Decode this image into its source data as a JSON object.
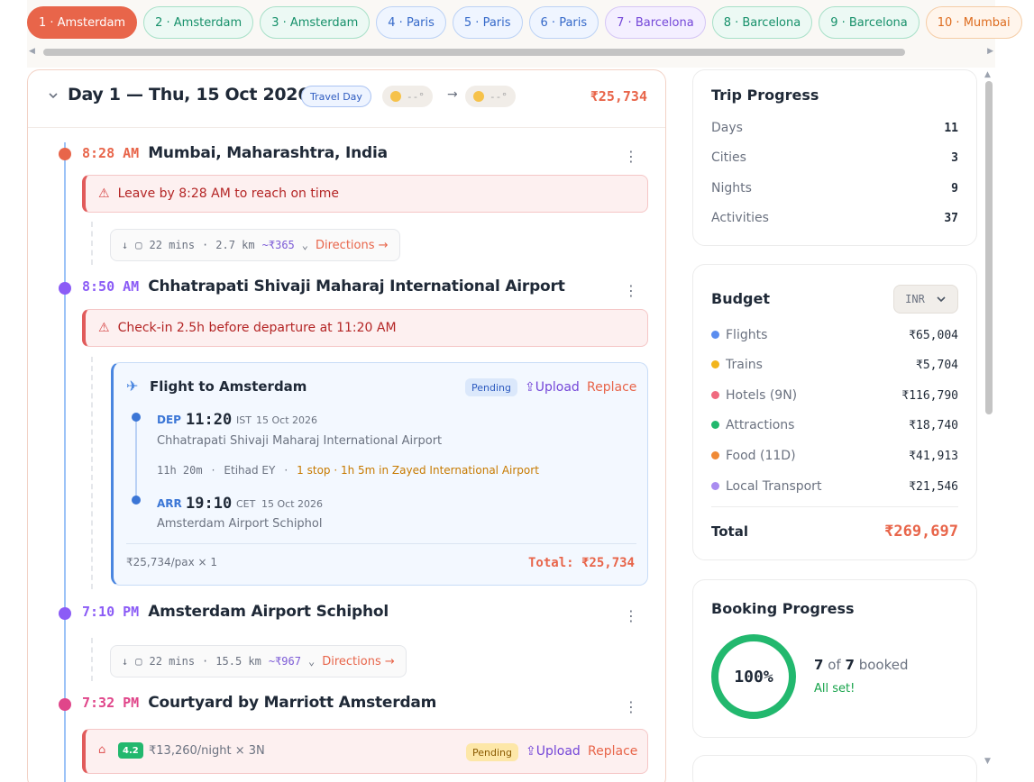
{
  "tabs": [
    {
      "label": "1 · Amsterdam",
      "kind": "active"
    },
    {
      "label": "2 · Amsterdam",
      "kind": "ams"
    },
    {
      "label": "3 · Amsterdam",
      "kind": "ams"
    },
    {
      "label": "4 · Paris",
      "kind": "par"
    },
    {
      "label": "5 · Paris",
      "kind": "par"
    },
    {
      "label": "6 · Paris",
      "kind": "par"
    },
    {
      "label": "7 · Barcelona",
      "kind": "bar"
    },
    {
      "label": "8 · Barcelona",
      "kind": "ams"
    },
    {
      "label": "9 · Barcelona",
      "kind": "ams"
    },
    {
      "label": "10 · Mumbai",
      "kind": "mum"
    }
  ],
  "day": {
    "title": "Day 1 — Thu, 15 Oct 2026",
    "tag": "Travel Day",
    "weather_from": "--°",
    "weather_to": "--°",
    "cost": "₹25,734"
  },
  "stops": [
    {
      "time": "8:28 AM",
      "name": "Mumbai, Maharashtra, India",
      "color": "#e8654a"
    },
    {
      "time": "8:50 AM",
      "name": "Chhatrapati Shivaji Maharaj International Airport",
      "color": "#8b5cf6"
    },
    {
      "time": "7:10 PM",
      "name": "Amsterdam Airport Schiphol",
      "color": "#8b5cf6"
    },
    {
      "time": "7:32 PM",
      "name": "Courtyard by Marriott Amsterdam",
      "color": "#e0468a"
    }
  ],
  "alerts": {
    "leave": "Leave by 8:28 AM to reach on time",
    "checkin": "Check-in 2.5h before departure at 11:20 AM"
  },
  "transits": [
    {
      "duration": "22 mins",
      "distance": "2.7 km",
      "price": "~₹365",
      "directions": "Directions →"
    },
    {
      "duration": "22 mins",
      "distance": "15.5 km",
      "price": "~₹967",
      "directions": "Directions →"
    }
  ],
  "flight": {
    "title": "Flight to Amsterdam",
    "status": "Pending",
    "upload": "Upload",
    "replace": "Replace",
    "dep_label": "DEP",
    "dep_time": "11:20",
    "dep_tz": "IST",
    "dep_date": "15 Oct 2026",
    "dep_airport": "Chhatrapati Shivaji Maharaj International Airport",
    "duration": "11h 20m",
    "airline": "Etihad EY",
    "stops": "1 stop · 1h 5m in Zayed International Airport",
    "arr_label": "ARR",
    "arr_time": "19:10",
    "arr_tz": "CET",
    "arr_date": "15 Oct 2026",
    "arr_airport": "Amsterdam Airport Schiphol",
    "pax": "₹25,734/pax × 1",
    "total": "Total: ₹25,734"
  },
  "hotel": {
    "rating": "4.2",
    "price": "₹13,260/night × 3N",
    "status": "Pending",
    "upload": "Upload",
    "replace": "Replace"
  },
  "trip_progress": {
    "title": "Trip Progress",
    "rows": [
      {
        "label": "Days",
        "value": "11"
      },
      {
        "label": "Cities",
        "value": "3"
      },
      {
        "label": "Nights",
        "value": "9"
      },
      {
        "label": "Activities",
        "value": "37"
      }
    ]
  },
  "budget": {
    "title": "Budget",
    "currency": "INR",
    "rows": [
      {
        "label": "Flights",
        "value": "₹65,004",
        "color": "#5b8def"
      },
      {
        "label": "Trains",
        "value": "₹5,704",
        "color": "#f2b51c"
      },
      {
        "label": "Hotels (9N)",
        "value": "₹116,790",
        "color": "#f06a7f"
      },
      {
        "label": "Attractions",
        "value": "₹18,740",
        "color": "#22b86e"
      },
      {
        "label": "Food (11D)",
        "value": "₹41,913",
        "color": "#f08a36"
      },
      {
        "label": "Local Transport",
        "value": "₹21,546",
        "color": "#a98cf0"
      }
    ],
    "total_label": "Total",
    "total_value": "₹269,697"
  },
  "booking": {
    "title": "Booking Progress",
    "percent": "100%",
    "booked_num": "7",
    "of": "of",
    "booked_total": "7",
    "booked_word": "booked",
    "status": "All set!"
  }
}
